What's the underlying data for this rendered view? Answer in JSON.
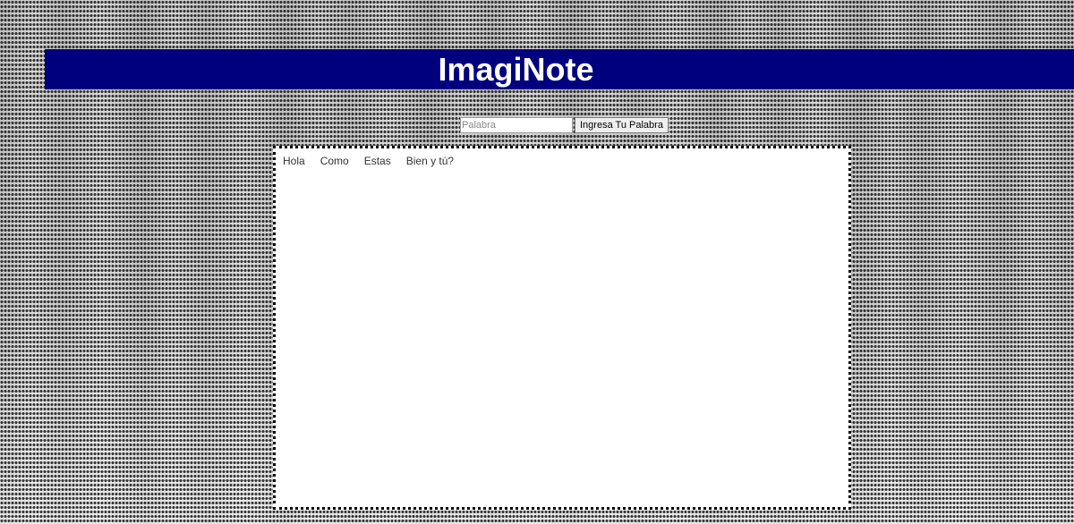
{
  "header": {
    "title": "ImagiNote"
  },
  "word_form": {
    "input_value": "",
    "input_placeholder": "Palabra",
    "submit_label": "Ingresa Tu Palabra"
  },
  "board": {
    "words": [
      "Hola",
      "Como",
      "Estas",
      "Bien y tú?"
    ]
  },
  "colors": {
    "banner_background": "#00007f",
    "banner_text": "#ffffff",
    "board_background": "#ffffff",
    "board_border": "#000000"
  }
}
